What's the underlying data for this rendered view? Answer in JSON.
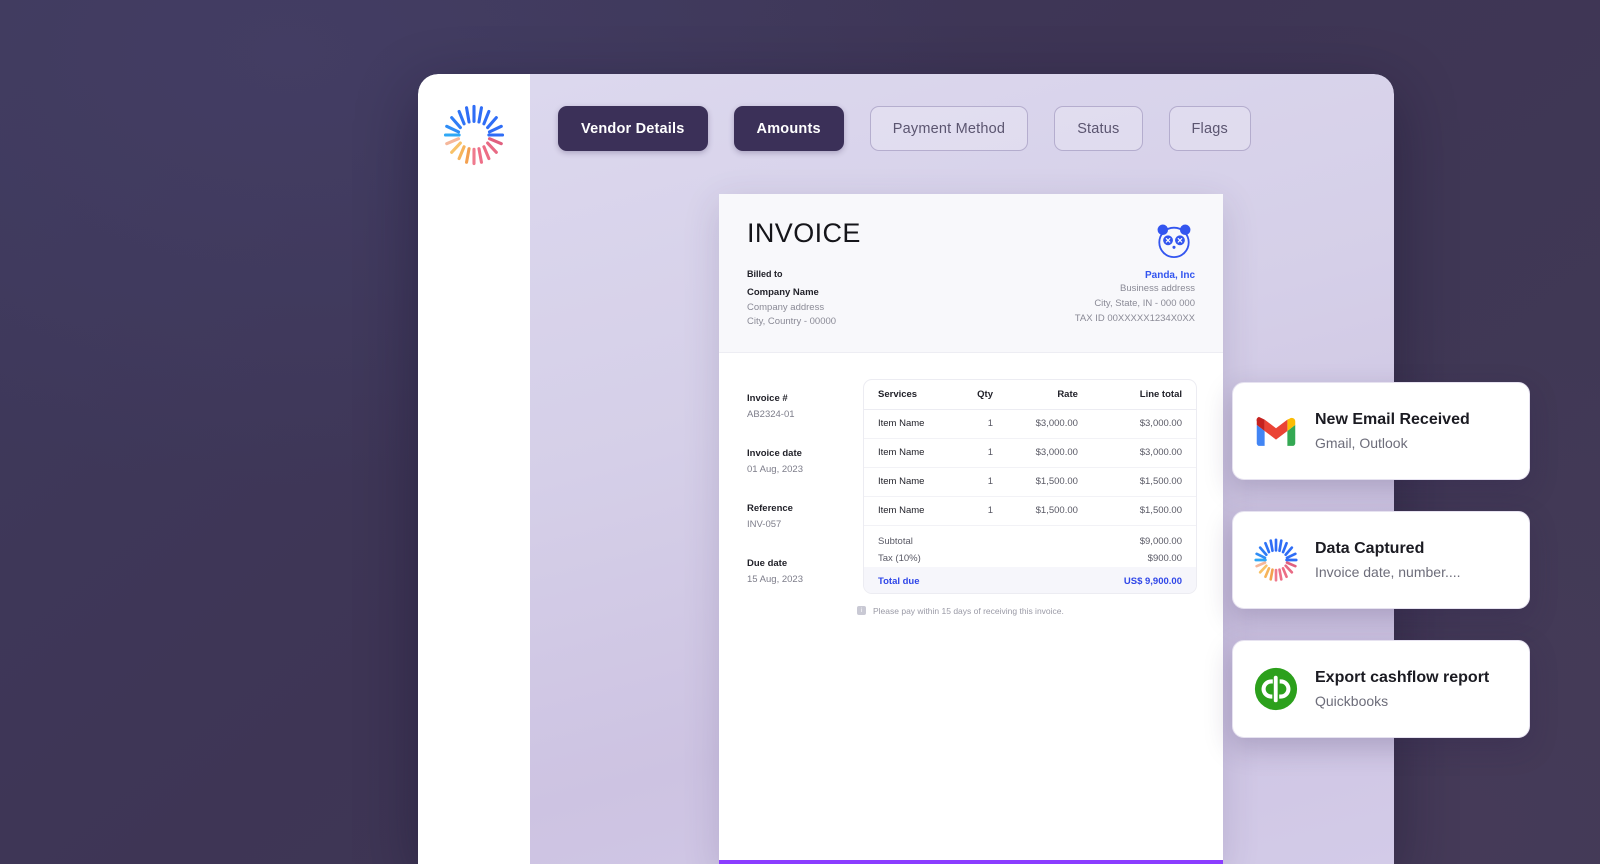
{
  "app": {
    "logo_icon": "radial-burst-logo"
  },
  "nav": {
    "tabs": [
      {
        "label": "Vendor Details",
        "state": "active"
      },
      {
        "label": "Amounts",
        "state": "active"
      },
      {
        "label": "Payment Method",
        "state": "idle"
      },
      {
        "label": "Status",
        "state": "idle"
      },
      {
        "label": "Flags",
        "state": "idle"
      }
    ]
  },
  "invoice": {
    "title": "INVOICE",
    "billed": {
      "heading": "Billed to",
      "company_name": "Company Name",
      "address_line1": "Company address",
      "address_line2": "City, Country - 00000"
    },
    "vendor": {
      "logo_icon": "panda-logo",
      "name": "Panda, Inc",
      "address_line1": "Business address",
      "address_line2": "City, State, IN - 000 000",
      "tax_id": "TAX ID 00XXXXX1234X0XX"
    },
    "meta": [
      {
        "label": "Invoice #",
        "value": "AB2324-01"
      },
      {
        "label": "Invoice date",
        "value": "01 Aug, 2023"
      },
      {
        "label": "Reference",
        "value": "INV-057"
      },
      {
        "label": "Due date",
        "value": "15 Aug, 2023"
      }
    ],
    "table": {
      "columns": [
        "Services",
        "Qty",
        "Rate",
        "Line total"
      ],
      "rows": [
        {
          "service": "Item Name",
          "qty": "1",
          "rate": "$3,000.00",
          "line_total": "$3,000.00"
        },
        {
          "service": "Item Name",
          "qty": "1",
          "rate": "$3,000.00",
          "line_total": "$3,000.00"
        },
        {
          "service": "Item Name",
          "qty": "1",
          "rate": "$1,500.00",
          "line_total": "$1,500.00"
        },
        {
          "service": "Item Name",
          "qty": "1",
          "rate": "$1,500.00",
          "line_total": "$1,500.00"
        }
      ],
      "summary": [
        {
          "label": "Subtotal",
          "value": "$9,000.00"
        },
        {
          "label": "Tax (10%)",
          "value": "$900.00"
        }
      ],
      "total": {
        "label": "Total due",
        "value": "US$ 9,900.00"
      }
    },
    "payment_note": "Please pay within 15 days of receiving this invoice.",
    "accent_color": "#8b3dff"
  },
  "notifications": [
    {
      "title": "New Email Received",
      "subtitle": "Gmail, Outlook",
      "icon": "gmail-icon"
    },
    {
      "title": "Data Captured",
      "subtitle": "Invoice date, number....",
      "icon": "radial-burst-logo"
    },
    {
      "title": "Export cashflow report",
      "subtitle": "Quickbooks",
      "icon": "quickbooks-icon"
    }
  ]
}
